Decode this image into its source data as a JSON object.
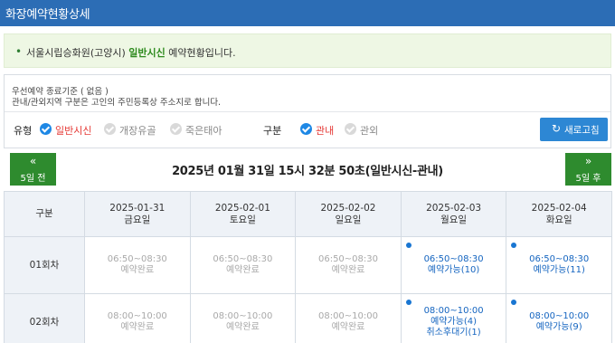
{
  "title": "화장예약현황상세",
  "notice": {
    "bullet": "•",
    "prefix": "서울시립승화원(고양시)",
    "highlight": "일반시신",
    "suffix": "예약현황입니다."
  },
  "criteria": {
    "line1": "우선예약 종료기준 ( 없음 )",
    "line2": "관내/관외지역 구분은 고인의 주민등록상 주소지로 합니다."
  },
  "filters": {
    "type_label": "유형",
    "types": [
      {
        "label": "일반시신",
        "checked": true
      },
      {
        "label": "개장유골",
        "checked": false
      },
      {
        "label": "죽은태아",
        "checked": false
      }
    ],
    "area_label": "구분",
    "areas": [
      {
        "label": "관내",
        "checked": true
      },
      {
        "label": "관외",
        "checked": false
      }
    ],
    "refresh_icon": "refresh-icon",
    "refresh_label": "새로고침"
  },
  "nav": {
    "prev_arrow": "«",
    "prev_label": "5일 전",
    "next_arrow": "»",
    "next_label": "5일 후",
    "current": "2025년 01월 31일 15시 32분 50초(일반시신-관내)"
  },
  "colors": {
    "header": "#2c6db5",
    "nav_button": "#2e8b2e",
    "refresh_button": "#2d87d4",
    "available": "#1565c0",
    "done": "#a9a9a9",
    "selected": "#e53935"
  },
  "table": {
    "corner": "구분",
    "days": [
      {
        "date": "2025-01-31",
        "weekday": "금요일"
      },
      {
        "date": "2025-02-01",
        "weekday": "토요일"
      },
      {
        "date": "2025-02-02",
        "weekday": "일요일"
      },
      {
        "date": "2025-02-03",
        "weekday": "월요일"
      },
      {
        "date": "2025-02-04",
        "weekday": "화요일"
      }
    ],
    "rows": [
      {
        "label": "01회차",
        "cells": [
          {
            "time": "06:50~08:30",
            "status": "예약완료",
            "wait": ""
          },
          {
            "time": "06:50~08:30",
            "status": "예약완료",
            "wait": ""
          },
          {
            "time": "06:50~08:30",
            "status": "예약완료",
            "wait": ""
          },
          {
            "time": "06:50~08:30",
            "status": "예약가능(10)",
            "wait": ""
          },
          {
            "time": "06:50~08:30",
            "status": "예약가능(11)",
            "wait": ""
          }
        ]
      },
      {
        "label": "02회차",
        "cells": [
          {
            "time": "08:00~10:00",
            "status": "예약완료",
            "wait": ""
          },
          {
            "time": "08:00~10:00",
            "status": "예약완료",
            "wait": ""
          },
          {
            "time": "08:00~10:00",
            "status": "예약완료",
            "wait": ""
          },
          {
            "time": "08:00~10:00",
            "status": "예약가능(4)",
            "wait": "취소후대기(1)"
          },
          {
            "time": "08:00~10:00",
            "status": "예약가능(9)",
            "wait": ""
          }
        ]
      }
    ]
  }
}
